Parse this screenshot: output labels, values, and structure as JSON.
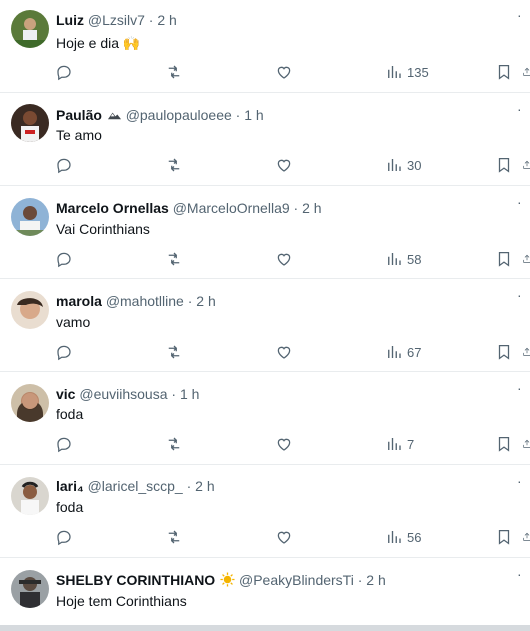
{
  "replies": [
    {
      "name": "Luiz",
      "badge": "",
      "handle": "@Lzsilv7",
      "time": "2 h",
      "text": "Hoje e dia 🙌",
      "views": "135",
      "avatar": "avatar-1"
    },
    {
      "name": "Paulão",
      "badge": "mountain-flag",
      "handle": "@paulopauloeee",
      "time": "1 h",
      "text": "Te amo",
      "views": "30",
      "avatar": "avatar-2"
    },
    {
      "name": "Marcelo Ornellas",
      "badge": "",
      "handle": "@MarceloOrnella9",
      "time": "2 h",
      "text": "Vai Corinthians",
      "views": "58",
      "avatar": "avatar-3"
    },
    {
      "name": "marola",
      "badge": "",
      "handle": "@mahotlline",
      "time": "2 h",
      "text": "vamo",
      "views": "67",
      "avatar": "avatar-4"
    },
    {
      "name": "vic",
      "badge": "",
      "handle": "@euviihsousa",
      "time": "1 h",
      "text": "foda",
      "views": "7",
      "avatar": "avatar-5"
    },
    {
      "name": "lari₄",
      "badge": "",
      "handle": "@laricel_sccp_",
      "time": "2 h",
      "text": "foda",
      "views": "56",
      "avatar": "avatar-6"
    },
    {
      "name": "SHELBY CORINTHIANO",
      "badge": "sun",
      "handle": "@PeakyBlindersTi",
      "time": "2 h",
      "text": "Hoje tem Corinthians",
      "views": "",
      "avatar": "avatar-7"
    }
  ],
  "separator": "·",
  "colors": {
    "text": "#0f1419",
    "secondary": "#536471",
    "divider": "#e9ecee"
  }
}
